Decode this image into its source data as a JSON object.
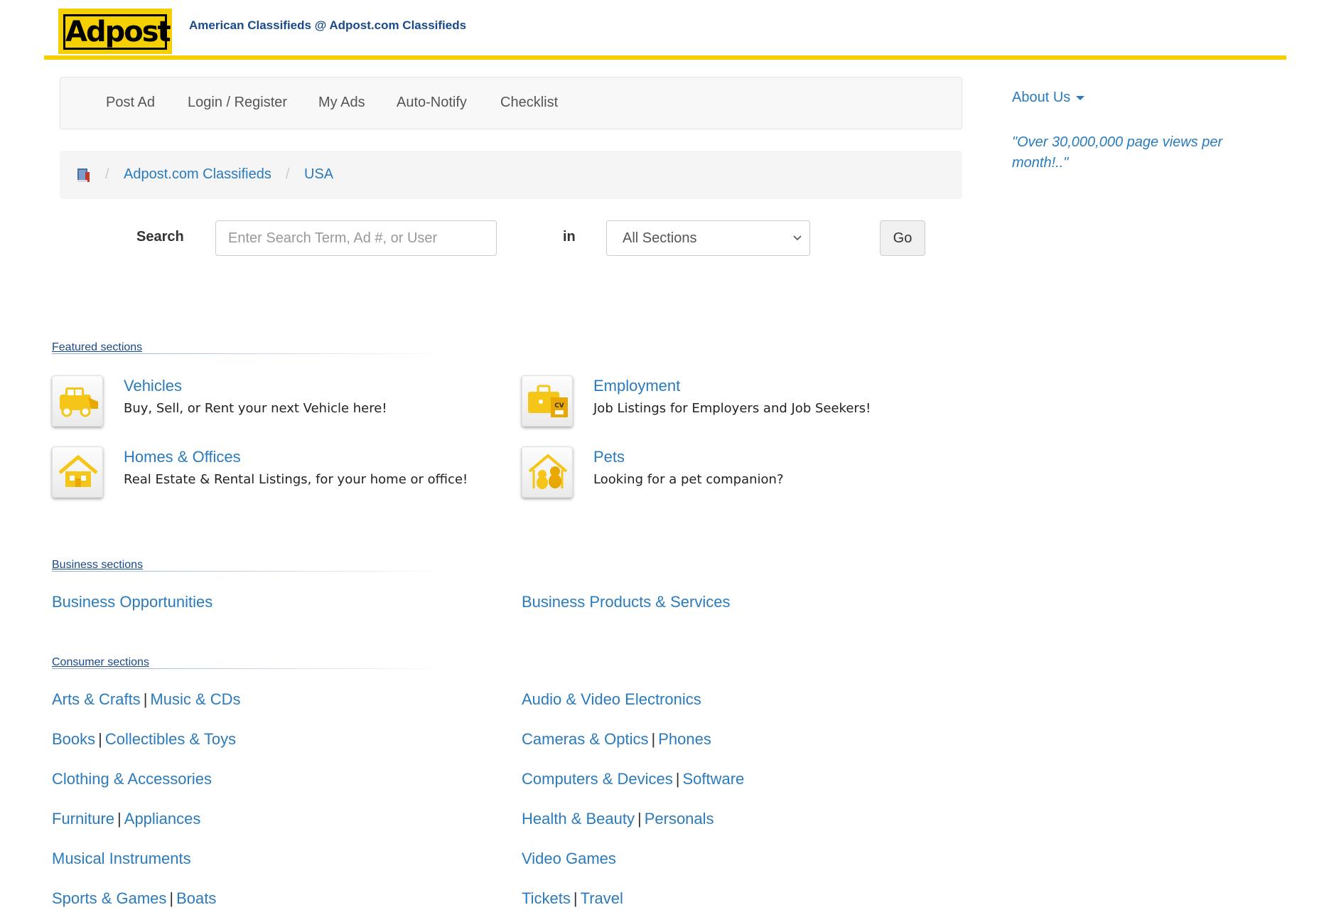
{
  "header": {
    "logo_text": "Adpost",
    "tagline": "American Classifieds @ Adpost.com Classifieds"
  },
  "nav": {
    "items": [
      "Post Ad",
      "Login / Register",
      "My Ads",
      "Auto-Notify",
      "Checklist"
    ]
  },
  "breadcrumb": {
    "icon": "book-icon",
    "separator": "/",
    "items": [
      "Adpost.com Classifieds",
      "USA"
    ]
  },
  "search": {
    "label": "Search",
    "placeholder": "Enter Search Term, Ad #, or User",
    "in_label": "in",
    "section_value": "All Sections",
    "go_label": "Go"
  },
  "sidebar": {
    "about_label": "About Us",
    "quote": "\"Over 30,000,000 page views per month!..\""
  },
  "featured": {
    "header": "Featured sections",
    "items": [
      {
        "title": "Vehicles",
        "desc": "Buy, Sell, or Rent your next Vehicle here!",
        "icon": "car-icon"
      },
      {
        "title": "Employment",
        "desc": "Job Listings for Employers and Job Seekers!",
        "icon": "briefcase-cv-icon"
      },
      {
        "title": "Homes & Offices",
        "desc": "Real Estate & Rental Listings, for your home or office!",
        "icon": "house-icon"
      },
      {
        "title": "Pets",
        "desc": "Looking for a pet companion?",
        "icon": "pets-icon"
      }
    ]
  },
  "business": {
    "header": "Business sections",
    "items": [
      "Business Opportunities",
      "Business Products & Services"
    ]
  },
  "consumer": {
    "header": "Consumer sections",
    "left": [
      [
        "Arts & Crafts",
        "Music & CDs"
      ],
      [
        "Books",
        "Collectibles & Toys"
      ],
      [
        "Clothing & Accessories"
      ],
      [
        "Furniture",
        "Appliances"
      ],
      [
        "Musical Instruments"
      ],
      [
        "Sports & Games",
        "Boats"
      ]
    ],
    "right": [
      [
        "Audio & Video Electronics"
      ],
      [
        "Cameras & Optics",
        "Phones"
      ],
      [
        "Computers & Devices",
        "Software"
      ],
      [
        "Health & Beauty",
        "Personals"
      ],
      [
        "Video Games"
      ],
      [
        "Tickets",
        "Travel"
      ]
    ],
    "pipe": "|"
  },
  "colors": {
    "accent_yellow": "#f5d000",
    "link_blue": "#2a7bbd",
    "tagline_blue": "#1a4a8a"
  }
}
